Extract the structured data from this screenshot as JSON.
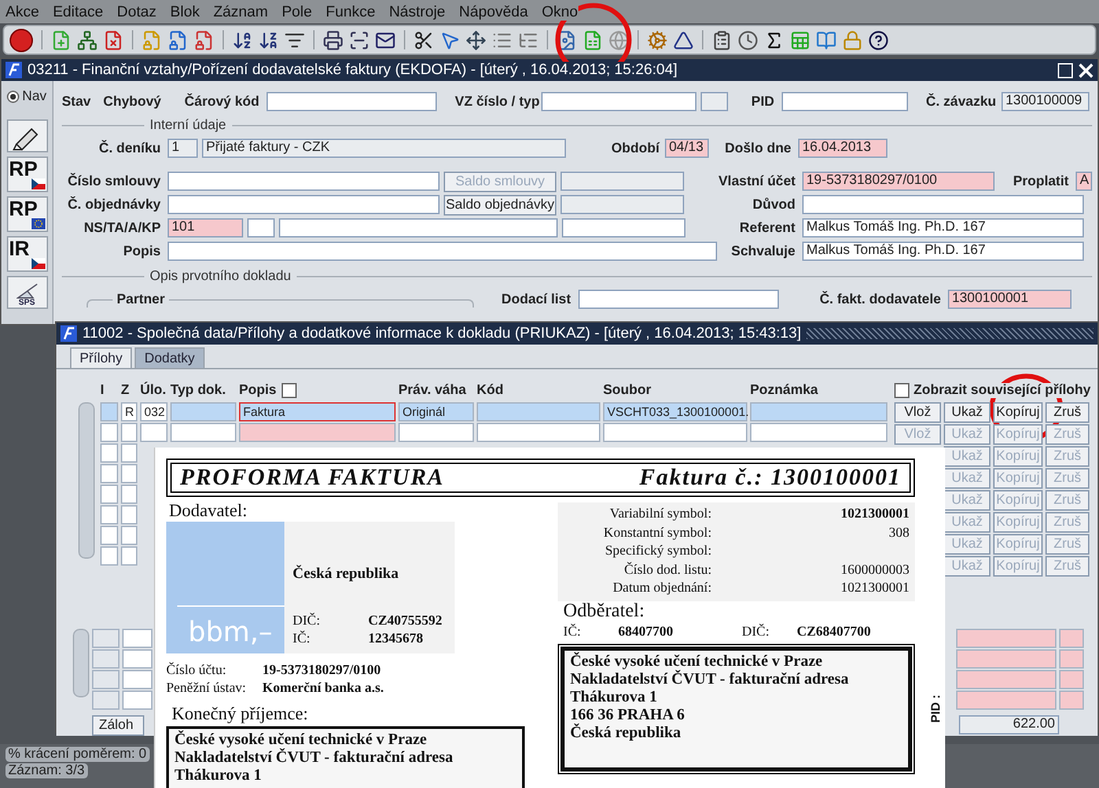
{
  "menu": [
    "Akce",
    "Editace",
    "Dotaz",
    "Blok",
    "Záznam",
    "Pole",
    "Funkce",
    "Nástroje",
    "Nápověda",
    "Okno"
  ],
  "main_window": {
    "title": "03211 - Finanční vztahy/Pořízení dodavatelské faktury (EKDOFA) - [úterý , 16.04.2013; 15:26:04]",
    "nav": {
      "label": "Nav",
      "selected": true
    },
    "nav_buttons": [
      {
        "label": "RP",
        "kind": "czech"
      },
      {
        "label": "RP",
        "kind": "eu"
      },
      {
        "label": "IR",
        "kind": "czech"
      }
    ],
    "nav_badge": "SPS",
    "status": {
      "label": "Stav",
      "value": "Chybový"
    },
    "top_groups": [
      {
        "label": "Čárový kód",
        "items": [
          {
            "kind": "field"
          }
        ]
      },
      {
        "label": "VZ číslo / typ",
        "items": [
          {
            "kind": "field"
          },
          {
            "kind": "readonly"
          }
        ]
      },
      {
        "label": "PID",
        "items": [
          {
            "kind": "field"
          }
        ]
      },
      {
        "label": "Č. závazku",
        "items": [
          {
            "kind": "readonly",
            "value": "1300100009"
          }
        ]
      }
    ],
    "internal_title": "Interní údaje",
    "internal_rows": [
      {
        "groups": [
          {
            "label": "Č. deníku",
            "items": [
              {
                "kind": "readonly",
                "value": "1"
              },
              {
                "kind": "readonly",
                "value": "Přijaté faktury - CZK"
              }
            ]
          },
          {
            "label": "Období",
            "items": [
              {
                "kind": "required",
                "value": "04/13"
              }
            ]
          },
          {
            "label": "Došlo dne",
            "items": [
              {
                "kind": "required",
                "value": "16.04.2013"
              }
            ]
          }
        ]
      },
      {
        "groups": [
          {
            "label": "Číslo smlouvy",
            "items": [
              {
                "kind": "field"
              },
              {
                "kind": "button",
                "label": "Saldo smlouvy",
                "disabled": true
              },
              {
                "kind": "readonly"
              }
            ]
          },
          {
            "label": "Vlastní účet",
            "items": [
              {
                "kind": "required",
                "value": "19-5373180297/0100"
              }
            ]
          },
          {
            "label": "Proplatit",
            "items": [
              {
                "kind": "required",
                "value": "A"
              }
            ]
          }
        ]
      },
      {
        "groups": [
          {
            "label": "Č. objednávky",
            "items": [
              {
                "kind": "field"
              },
              {
                "kind": "button",
                "label": "Saldo objednávky",
                "disabled": false
              },
              {
                "kind": "readonly"
              }
            ]
          },
          {
            "label": "Důvod",
            "items": [
              {
                "kind": "field"
              }
            ]
          }
        ]
      },
      {
        "groups": [
          {
            "label": "NS/TA/A/KP",
            "items": [
              {
                "kind": "required",
                "value": "101"
              },
              {
                "kind": "field"
              },
              {
                "kind": "field"
              },
              {
                "kind": "field"
              }
            ]
          },
          {
            "label": "Referent",
            "items": [
              {
                "kind": "field",
                "value": "Malkus Tomáš Ing. Ph.D. 167"
              }
            ]
          }
        ]
      },
      {
        "groups": [
          {
            "label": "Popis",
            "items": [
              {
                "kind": "field"
              }
            ]
          },
          {
            "label": "Schvaluje",
            "items": [
              {
                "kind": "field",
                "value": "Malkus Tomáš Ing. Ph.D. 167"
              }
            ]
          }
        ]
      }
    ],
    "origin_title": "Opis prvotního dokladu",
    "partner_label": "Partner",
    "origin_groups": [
      {
        "label": "Dodací list",
        "items": [
          {
            "kind": "field"
          }
        ]
      },
      {
        "label": "Č. fakt. dodavatele",
        "items": [
          {
            "kind": "required",
            "value": "1300100001"
          }
        ]
      }
    ]
  },
  "sub_window": {
    "title": "11002 - Společná data/Přílohy a dodatkové informace k dokladu (PRIUKAZ) - [úterý , 16.04.2013; 15:43:13]",
    "tabs": [
      {
        "label": "Přílohy",
        "selected": true
      },
      {
        "label": "Dodatky",
        "selected": false
      }
    ],
    "table": {
      "columns": [
        "I",
        "Z",
        "Úlo.",
        "Typ dok.",
        "Popis",
        "Práv. váha",
        "Kód",
        "Soubor",
        "Poznámka"
      ],
      "popis_checkbox": {
        "checked": false
      },
      "rows": [
        {
          "selected": true,
          "cells": [
            {
              "focused": false
            },
            {
              "value": "R",
              "focused": false
            },
            {
              "value": "032",
              "focused": false
            },
            {
              "focused": false
            },
            {
              "value": "Faktura",
              "focused": true
            },
            {
              "value": "Originál",
              "focused": false
            },
            {
              "focused": false
            },
            {
              "value": "VSCHT033_1300100001.",
              "focused": false
            },
            {
              "focused": false
            }
          ]
        }
      ]
    },
    "show_related": {
      "label": "Zobrazit související přílohy",
      "checked": false
    },
    "action_rows": [
      {
        "buttons": [
          {
            "kind": "insert",
            "label": "Vlož",
            "disabled": false
          },
          {
            "kind": "show",
            "label": "Ukaž",
            "disabled": false
          },
          {
            "kind": "copy",
            "label": "Kopíruj",
            "disabled": false
          },
          {
            "kind": "delete",
            "label": "Zruš",
            "disabled": false
          }
        ]
      },
      {
        "buttons": [
          {
            "kind": "insert",
            "label": "Vlož",
            "disabled": true
          },
          {
            "kind": "show",
            "label": "Ukaž",
            "disabled": true
          },
          {
            "kind": "copy",
            "label": "Kopíruj",
            "disabled": true
          },
          {
            "kind": "delete",
            "label": "Zruš",
            "disabled": true
          }
        ]
      },
      {
        "buttons": [
          {
            "kind": "show",
            "label": "Ukaž",
            "disabled": true
          },
          {
            "kind": "copy",
            "label": "Kopíruj",
            "disabled": true
          },
          {
            "kind": "delete",
            "label": "Zruš",
            "disabled": true
          }
        ]
      },
      {
        "buttons": [
          {
            "kind": "show",
            "label": "Ukaž",
            "disabled": true
          },
          {
            "kind": "copy",
            "label": "Kopíruj",
            "disabled": true
          },
          {
            "kind": "delete",
            "label": "Zruš",
            "disabled": true
          }
        ]
      },
      {
        "buttons": [
          {
            "kind": "show",
            "label": "Ukaž",
            "disabled": true
          },
          {
            "kind": "copy",
            "label": "Kopíruj",
            "disabled": true
          },
          {
            "kind": "delete",
            "label": "Zruš",
            "disabled": true
          }
        ]
      },
      {
        "buttons": [
          {
            "kind": "show",
            "label": "Ukaž",
            "disabled": true
          },
          {
            "kind": "copy",
            "label": "Kopíruj",
            "disabled": true
          },
          {
            "kind": "delete",
            "label": "Zruš",
            "disabled": true
          }
        ]
      },
      {
        "buttons": [
          {
            "kind": "show",
            "label": "Ukaž",
            "disabled": true
          },
          {
            "kind": "copy",
            "label": "Kopíruj",
            "disabled": true
          },
          {
            "kind": "delete",
            "label": "Zruš",
            "disabled": true
          }
        ]
      },
      {
        "buttons": [
          {
            "kind": "show",
            "label": "Ukaž",
            "disabled": true
          },
          {
            "kind": "copy",
            "label": "Kopíruj",
            "disabled": true
          },
          {
            "kind": "delete",
            "label": "Zruš",
            "disabled": true
          }
        ]
      }
    ],
    "backup_button": "Záloh",
    "total": "622.00"
  },
  "document": {
    "title": "PROFORMA FAKTURA",
    "invoice_no": "Faktura č.: 1300100001",
    "supplier_label": "Dodavatel:",
    "logo_text": "bbm,–",
    "supplier_country": "Česká republika",
    "supplier_ids": [
      {
        "label": "DIČ:",
        "value": "CZ40755592"
      },
      {
        "label": "IČ:",
        "value": "12345678"
      }
    ],
    "payment": [
      {
        "label": "Číslo účtu:",
        "value": "19-5373180297/0100"
      },
      {
        "label": "Peněžní ústav:",
        "value": "Komerční banka a.s."
      }
    ],
    "symbols": [
      {
        "label": "Variabilní symbol:",
        "value": "1021300001",
        "kind": "bold"
      },
      {
        "label": "Konstantní symbol:",
        "value": "308",
        "kind": "plain"
      },
      {
        "label": "Specifický symbol:",
        "kind": "plain"
      },
      {
        "label": "Číslo dod. listu:",
        "value": "1600000003",
        "kind": "plain"
      },
      {
        "label": "Datum objednání:",
        "value": "1021300001",
        "kind": "plain"
      }
    ],
    "customer_label": "Odběratel:",
    "customer_ids": [
      {
        "label": "IČ:",
        "value": "68407700"
      },
      {
        "label": "DIČ:",
        "value": "CZ68407700"
      }
    ],
    "customer_address": [
      "České vysoké učení technické v Praze",
      "Nakladatelství ČVUT - fakturační adresa",
      "Thákurova 1",
      "166 36 PRAHA 6",
      "Česká republika"
    ],
    "recipient_label": "Konečný příjemce:",
    "recipient_address": [
      "České vysoké učení technické v Praze",
      "Nakladatelství ČVUT - fakturační adresa",
      "Thákurova 1"
    ],
    "side_label": "PID :"
  },
  "status_bar": {
    "reduction": "% krácení poměrem: 0",
    "record": "Záznam: 3/3"
  }
}
